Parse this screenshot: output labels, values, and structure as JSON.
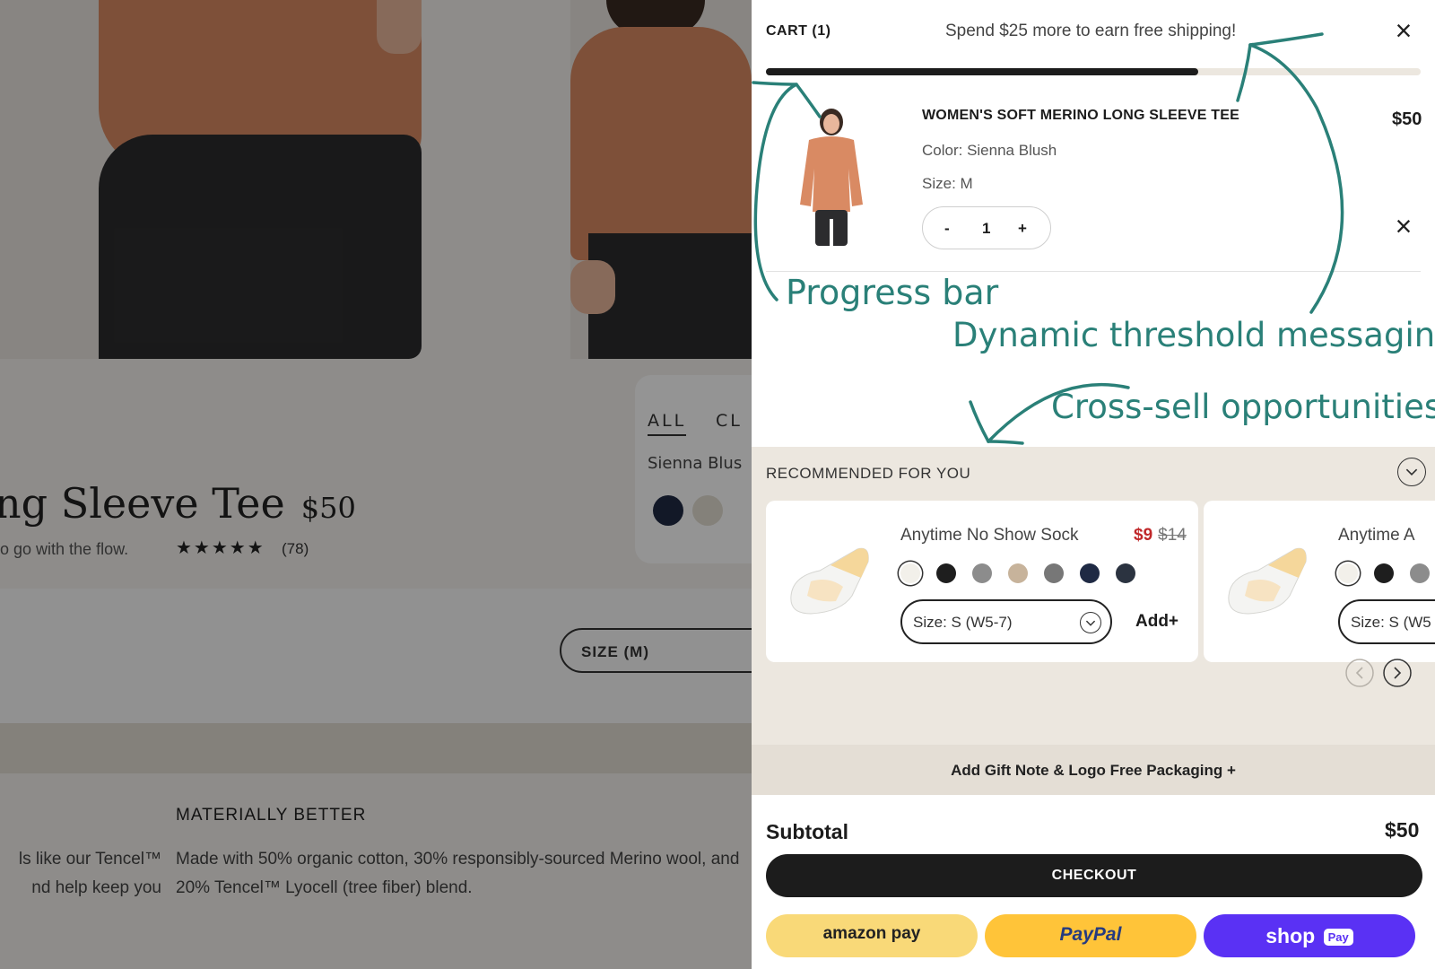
{
  "background_page": {
    "product_title": "ng Sleeve Tee",
    "product_price": "$50",
    "subtitle": "o go with the flow.",
    "stars": "★★★★★",
    "rating": 4.5,
    "review_count": "(78)",
    "variant_tabs": [
      "ALL",
      "CL"
    ],
    "variant_color_label": "Sienna Blus",
    "size_selector": "SIZE (M)",
    "materially_heading": "MATERIALLY BETTER",
    "materially_body": "Made with 50% organic cotton, 30% responsibly-sourced Merino wool, and 20% Tencel™ Lyocell (tree fiber) blend.",
    "left_column_lines": [
      "ls like our Tencel™",
      "nd help keep you"
    ]
  },
  "cart": {
    "title": "CART (1)",
    "shipping_message": "Spend $25 more to earn free shipping!",
    "close_icon": "×",
    "progress_fraction": 0.66,
    "item": {
      "name": "WOMEN'S SOFT MERINO LONG SLEEVE TEE",
      "price": "$50",
      "color": "Color: Sienna Blush",
      "size": "Size: M",
      "qty_minus": "-",
      "qty": "1",
      "qty_plus": "+",
      "remove_icon": "×"
    }
  },
  "annotations": {
    "progress_bar": "Progress bar",
    "threshold": "Dynamic threshold messaging",
    "cross_sell": "Cross-sell opportunities"
  },
  "recommendations": {
    "heading": "RECOMMENDED FOR YOU",
    "cards": [
      {
        "name": "Anytime No Show Sock",
        "sale_price": "$9",
        "original_price": "$14",
        "size": "Size: S (W5-7)",
        "add": "Add+"
      },
      {
        "name": "Anytime A",
        "size": "Size: S (W5"
      }
    ],
    "swatch_colors": [
      "#f2f0ea",
      "#1e1e1e",
      "#8c8c8c",
      "#c7b39b",
      "#777777",
      "#1f2a44",
      "#2b3340"
    ]
  },
  "footer": {
    "gift_note": "Add Gift Note & Logo Free Packaging +",
    "subtotal_label": "Subtotal",
    "subtotal_value": "$50",
    "checkout": "CHECKOUT",
    "pay_buttons": {
      "amazon": "amazon pay",
      "paypal": "PayPal",
      "shop": "shop",
      "shop_badge": "Pay"
    }
  },
  "colors": {
    "accent_teal": "#2a8078",
    "sale_red": "#c0282a",
    "shop_purple": "#5a31f4",
    "paypal_yellow": "#ffc439",
    "amazon_yellow": "#f9d978"
  }
}
